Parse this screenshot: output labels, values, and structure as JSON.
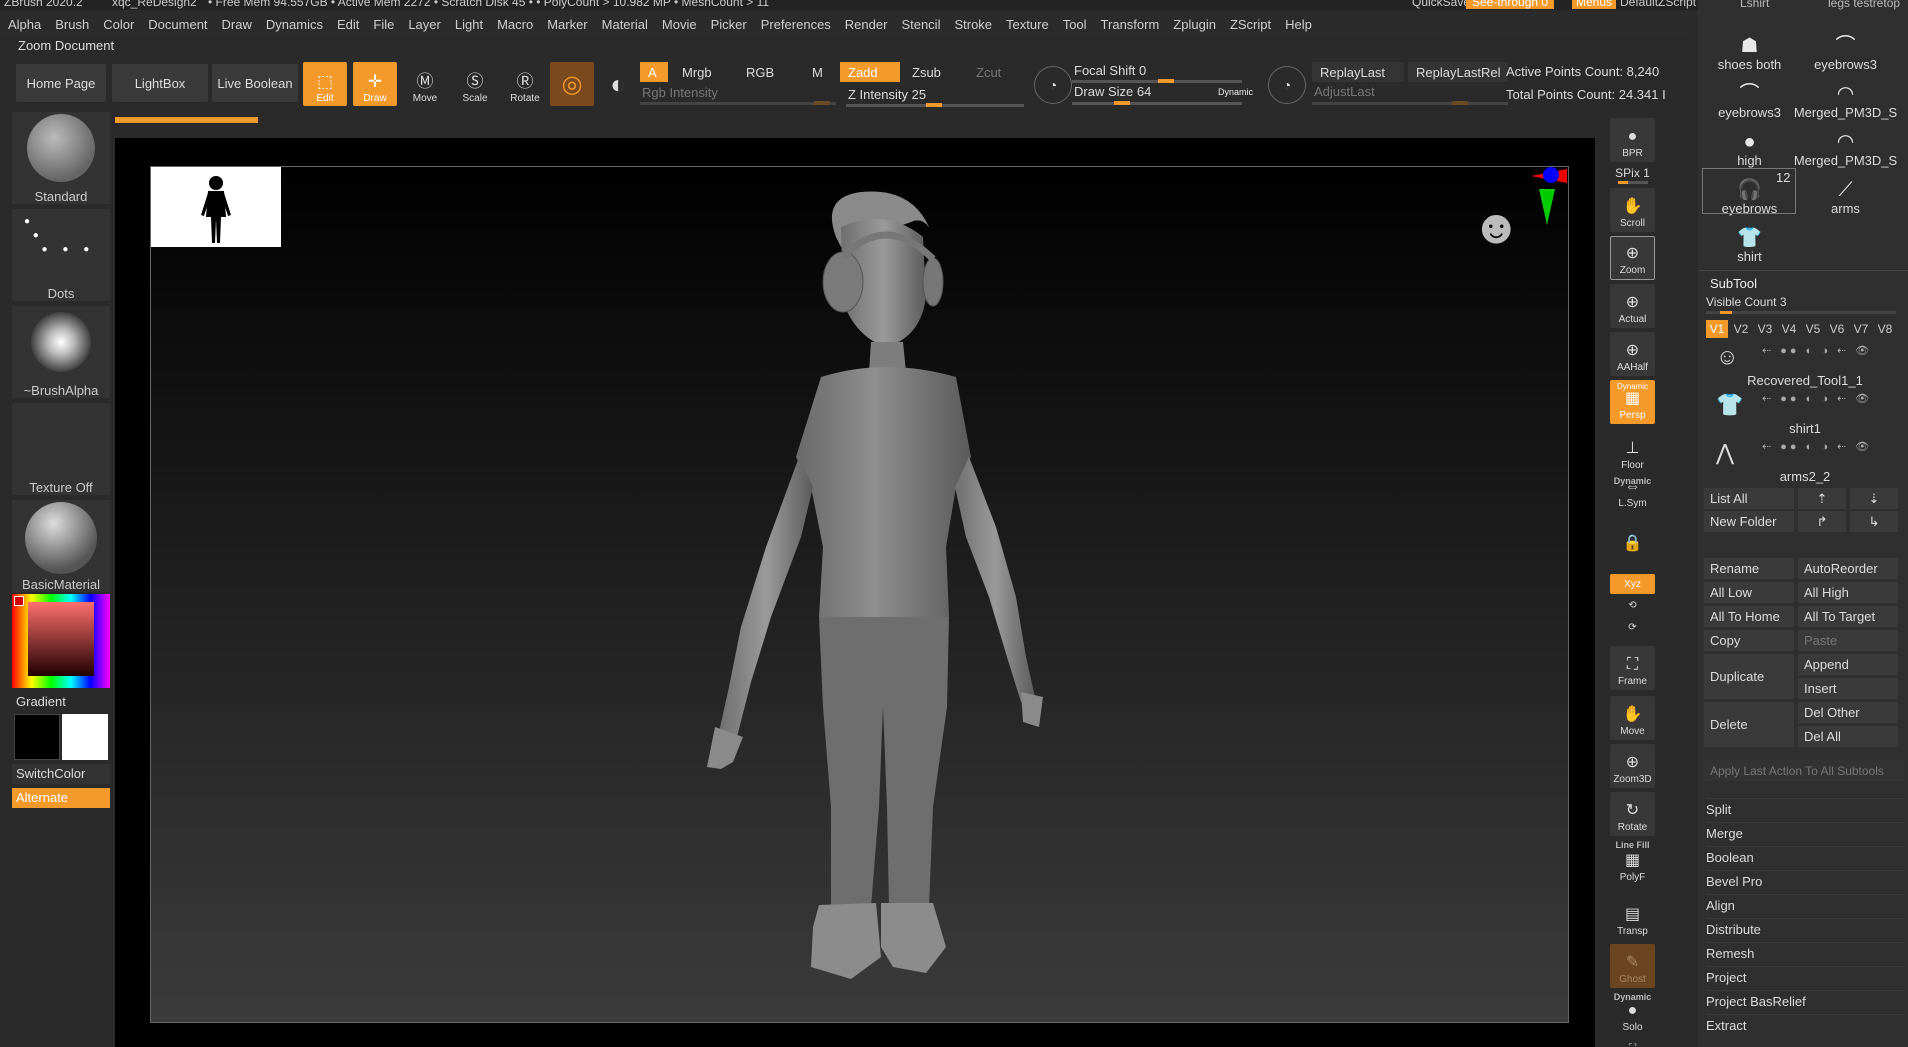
{
  "titlebar": {
    "app": "ZBrush 2020.2",
    "doc": "xqc_ReDesign2",
    "free_mem": "• Free Mem 94.557GB • Active Mem 2272 • Scratch Disk 45 • • PolyCount > 10.982 MP • MeshCount > 11",
    "quicksave": "QuickSave",
    "see_through": "See-through  0",
    "menus": "Menus",
    "script": "DefaultZScript"
  },
  "menubar": [
    "Alpha",
    "Brush",
    "Color",
    "Document",
    "Draw",
    "Dynamics",
    "Edit",
    "File",
    "Layer",
    "Light",
    "Macro",
    "Marker",
    "Material",
    "Movie",
    "Picker",
    "Preferences",
    "Render",
    "Stencil",
    "Stroke",
    "Texture",
    "Tool",
    "Transform",
    "Zplugin",
    "ZScript",
    "Help"
  ],
  "zoom_doc": "Zoom Document",
  "toolbar": {
    "home_page": "Home Page",
    "lightbox": "LightBox",
    "live_boolean": "Live Boolean",
    "edit": "Edit",
    "draw": "Draw",
    "move": "Move",
    "scale": "Scale",
    "rotate": "Rotate",
    "a": "A",
    "mrgb": "Mrgb",
    "rgb": "RGB",
    "m": "M",
    "zadd": "Zadd",
    "zsub": "Zsub",
    "zcut": "Zcut",
    "rgb_intensity": "Rgb Intensity",
    "z_intensity_label": "Z Intensity",
    "z_intensity_value": "25",
    "focal_shift_label": "Focal Shift",
    "focal_shift_value": "0",
    "draw_size_label": "Draw Size",
    "draw_size_value": "64",
    "dynamic": "Dynamic",
    "replay_last": "ReplayLast",
    "replay_last_rel": "ReplayLastRel",
    "adjust_last": "AdjustLast",
    "active_points": "Active Points Count: 8,240",
    "total_points": "Total Points Count: 24.341 I"
  },
  "left_shelf": {
    "brush": "Standard",
    "stroke": "Dots",
    "alpha": "~BrushAlpha",
    "texture": "Texture Off",
    "material": "BasicMaterial",
    "gradient": "Gradient",
    "switch_color": "SwitchColor",
    "alternate": "Alternate"
  },
  "right_strip": {
    "bpr": "BPR",
    "spix": "SPix 1",
    "scroll": "Scroll",
    "zoom": "Zoom",
    "actual": "Actual",
    "aahalf": "AAHalf",
    "dynamic": "Dynamic",
    "persp": "Persp",
    "floor": "Floor",
    "dynamic2": "Dynamic",
    "lsym": "L.Sym",
    "xyz": "Xyz",
    "frame": "Frame",
    "move": "Move",
    "zoom3d": "Zoom3D",
    "rotate": "Rotate",
    "line_fill": "Line Fill",
    "polyf": "PolyF",
    "transp": "Transp",
    "ghost": "Ghost",
    "dynamic3": "Dynamic",
    "solo": "Solo"
  },
  "tool_panel": {
    "top_items": [
      {
        "label": "shoes both",
        "icon": "☗"
      },
      {
        "label": "eyebrows3",
        "icon": "⌒"
      },
      {
        "label": "eyebrows3",
        "icon": "⌒"
      },
      {
        "label": "Merged_PM3D_S",
        "icon": "◠"
      },
      {
        "label": "high",
        "icon": "●"
      },
      {
        "label": "Merged_PM3D_S",
        "icon": "◠"
      },
      {
        "label": "eyebrows",
        "icon": "🎧"
      },
      {
        "label": "arms",
        "icon": "⟋"
      },
      {
        "label": "shirt",
        "icon": "👕"
      }
    ],
    "top_cut_left": "Lshirt",
    "top_cut_right": "legs testretop",
    "eyebrows_count": "12",
    "subtool_title": "SubTool",
    "visible_count": "Visible Count 3",
    "versions": [
      "V1",
      "V2",
      "V3",
      "V4",
      "V5",
      "V6",
      "V7",
      "V8"
    ],
    "subtools": [
      {
        "name": "Recovered_Tool1_1",
        "icon": "☺"
      },
      {
        "name": "shirt1",
        "icon": "👕"
      },
      {
        "name": "arms2_2",
        "icon": "⋀"
      }
    ],
    "list_all": "List All",
    "new_folder": "New Folder",
    "rename": "Rename",
    "auto_reorder": "AutoReorder",
    "all_low": "All Low",
    "all_high": "All High",
    "all_to_home": "All To Home",
    "all_to_target": "All To Target",
    "copy": "Copy",
    "paste": "Paste",
    "duplicate": "Duplicate",
    "append": "Append",
    "insert": "Insert",
    "delete": "Delete",
    "del_other": "Del Other",
    "del_all": "Del All",
    "apply_last": "Apply Last Action To All Subtools",
    "menu": [
      "Split",
      "Merge",
      "Boolean",
      "Bevel Pro",
      "Align",
      "Distribute",
      "Remesh",
      "Project",
      "Project BasRelief",
      "Extract"
    ]
  },
  "colors": {
    "accent": "#f39a2b",
    "panel": "#2f2f2f",
    "button": "#3a3a3a"
  }
}
